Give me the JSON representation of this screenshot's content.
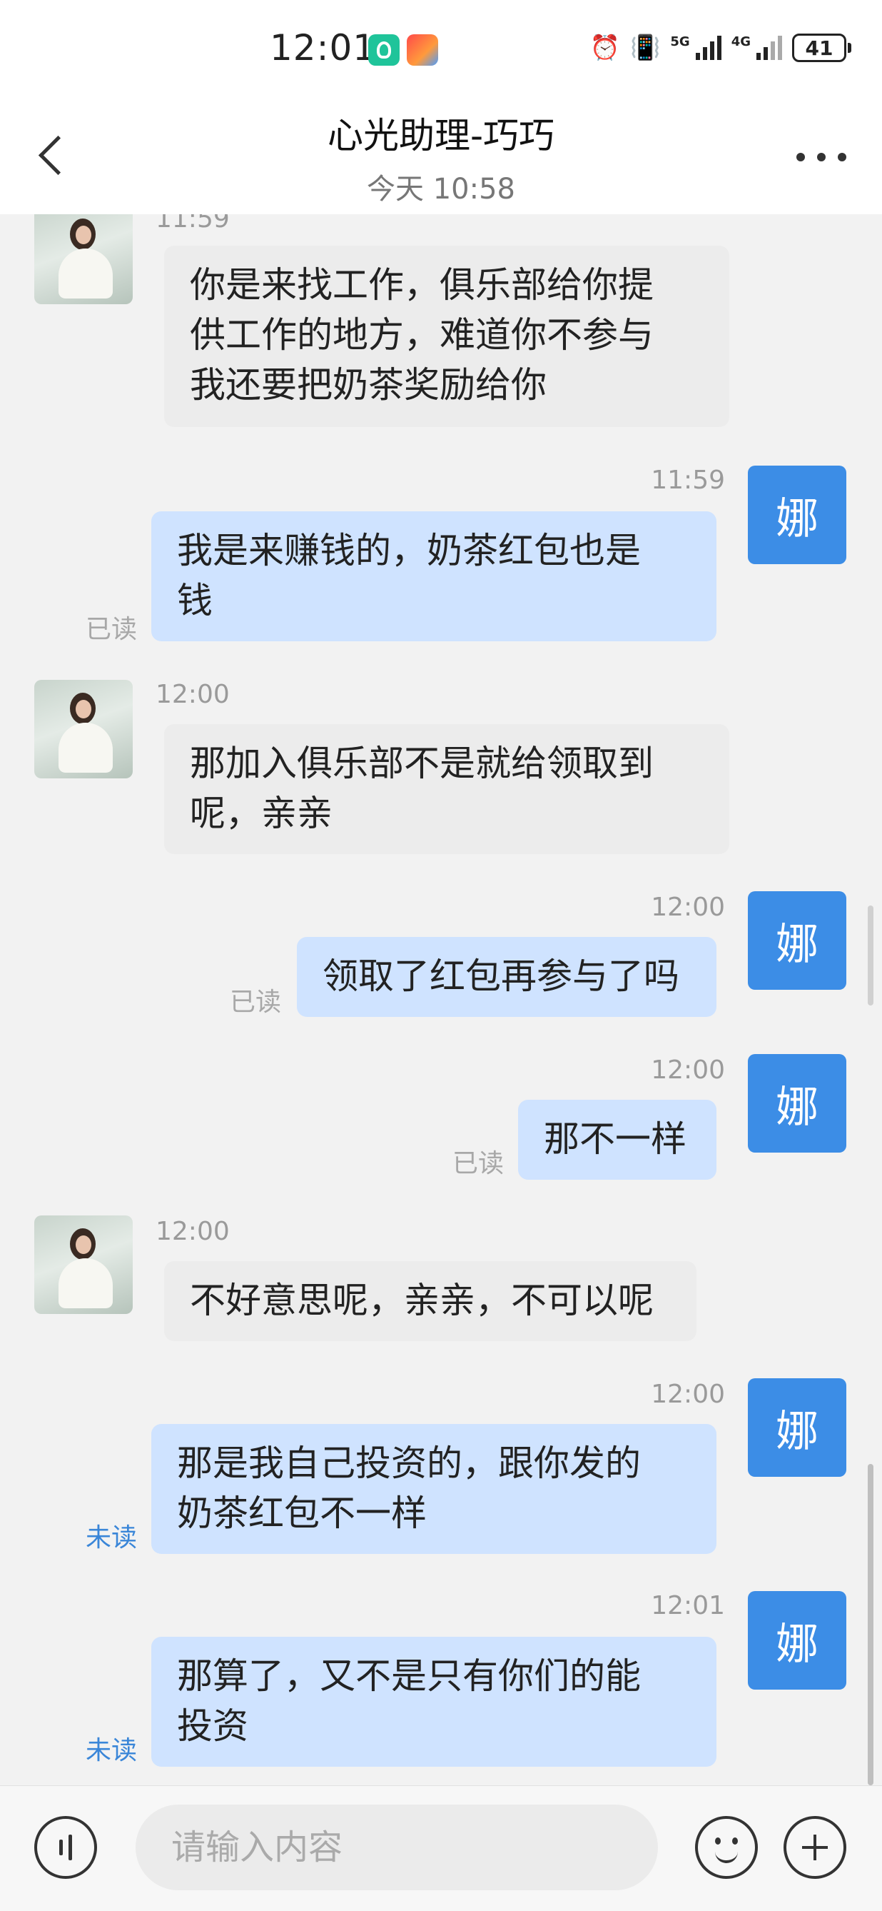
{
  "status_bar": {
    "time": "12:01",
    "battery": "41",
    "net1_label": "5G",
    "net2_label": "4G",
    "icons": [
      "alarm-icon",
      "vibrate-icon",
      "signal-5g-icon",
      "signal-4g-icon",
      "battery-icon"
    ]
  },
  "header": {
    "title": "心光助理-巧巧",
    "subtitle": "今天 10:58"
  },
  "messages": [
    {
      "dir": "in",
      "time": "11:59",
      "text": "你是来找工作，俱乐部给你提\n供工作的地方，难道你不参与\n我还要把奶茶奖励给你"
    },
    {
      "dir": "out",
      "time": "11:59",
      "text": "我是来赚钱的，奶茶红包也是\n钱",
      "status": "已读"
    },
    {
      "dir": "in",
      "time": "12:00",
      "text": "那加入俱乐部不是就给领取到\n呢，亲亲"
    },
    {
      "dir": "out",
      "time": "12:00",
      "text": "领取了红包再参与了吗",
      "status": "已读"
    },
    {
      "dir": "out",
      "time": "12:00",
      "text": "那不一样",
      "status": "已读"
    },
    {
      "dir": "in",
      "time": "12:00",
      "text": "不好意思呢，亲亲，不可以呢"
    },
    {
      "dir": "out",
      "time": "12:00",
      "text": "那是我自己投资的，跟你发的\n奶茶红包不一样",
      "status": "未读"
    },
    {
      "dir": "out",
      "time": "12:01",
      "text": "那算了，又不是只有你们的能\n投资",
      "status": "未读"
    }
  ],
  "avatar_out_label": "娜",
  "input": {
    "placeholder": "请输入内容",
    "value": ""
  },
  "colors": {
    "accent": "#3c8de6",
    "bubble_out": "#cfe3ff",
    "bubble_in": "#ececec",
    "unread": "#3a86d8"
  }
}
